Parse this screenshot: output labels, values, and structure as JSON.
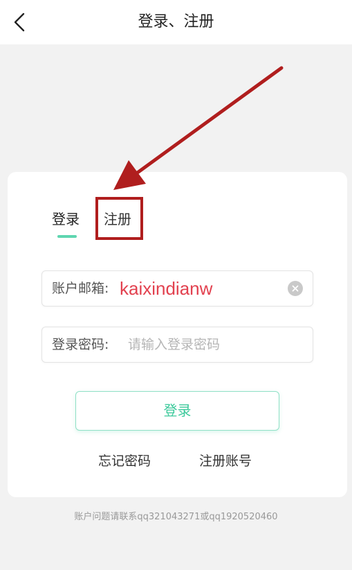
{
  "header": {
    "title": "登录、注册",
    "back_icon": "chevron-left-icon"
  },
  "tabs": [
    {
      "label": "登录",
      "active": true
    },
    {
      "label": "注册",
      "active": false
    }
  ],
  "form": {
    "email_label": "账户邮箱:",
    "email_value": "kaixindianw",
    "clear_icon": "clear-circle-icon",
    "password_label": "登录密码:",
    "password_placeholder": "请输入登录密码",
    "login_button": "登录"
  },
  "links": {
    "forgot_password": "忘记密码",
    "register_account": "注册账号"
  },
  "footer": {
    "note": "账户问题请联系qq321043271或qq1920520460"
  },
  "colors": {
    "accent": "#5fd6b0",
    "button_text": "#3cc99b",
    "annotation": "#b01e1e",
    "email_text": "#e2414f"
  }
}
